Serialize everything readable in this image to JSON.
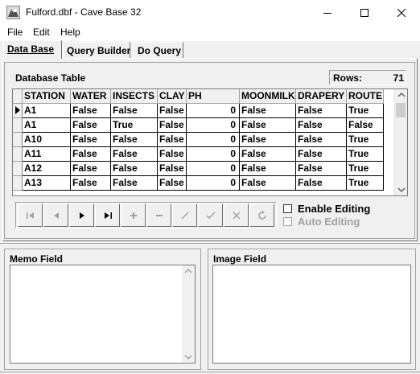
{
  "window": {
    "title": "Fulford.dbf - Cave Base 32",
    "icon": "cave-app-icon",
    "controls": [
      "minimize-icon",
      "maximize-icon",
      "close-icon"
    ]
  },
  "menu": {
    "items": [
      "File",
      "Edit",
      "Help"
    ]
  },
  "tabs": [
    {
      "label": "Data Base",
      "active": true
    },
    {
      "label": "Query Builder",
      "active": false
    },
    {
      "label": "Do Query",
      "active": false
    }
  ],
  "table_panel": {
    "title": "Database Table",
    "rows_label": "Rows:",
    "rows_value": "71"
  },
  "grid": {
    "columns": [
      "STATION",
      "WATER",
      "INSECTS",
      "CLAY",
      "PH",
      "MOONMILK",
      "DRAPERY",
      "ROUTE"
    ],
    "rows": [
      [
        "A1",
        "False",
        "False",
        "False",
        "0",
        "False",
        "False",
        "True"
      ],
      [
        "A1",
        "False",
        "True",
        "False",
        "0",
        "False",
        "False",
        "False"
      ],
      [
        "A10",
        "False",
        "False",
        "False",
        "0",
        "False",
        "False",
        "True"
      ],
      [
        "A11",
        "False",
        "False",
        "False",
        "0",
        "False",
        "False",
        "True"
      ],
      [
        "A12",
        "False",
        "False",
        "False",
        "0",
        "False",
        "False",
        "True"
      ],
      [
        "A13",
        "False",
        "False",
        "False",
        "0",
        "False",
        "False",
        "True"
      ]
    ],
    "current_row_indicator": "current-row-arrow-icon"
  },
  "navigator": {
    "buttons": [
      {
        "name": "first-record",
        "icon": "first-record-icon",
        "enabled": false
      },
      {
        "name": "prior-record",
        "icon": "prior-record-icon",
        "enabled": false
      },
      {
        "name": "next-record",
        "icon": "next-record-icon",
        "enabled": true
      },
      {
        "name": "last-record",
        "icon": "last-record-icon",
        "enabled": true
      },
      {
        "name": "insert-record",
        "icon": "plus-icon",
        "enabled": false
      },
      {
        "name": "delete-record",
        "icon": "minus-icon",
        "enabled": false
      },
      {
        "name": "edit-record",
        "icon": "edit-icon",
        "enabled": false
      },
      {
        "name": "post-edit",
        "icon": "check-icon",
        "enabled": false
      },
      {
        "name": "cancel-edit",
        "icon": "x-icon",
        "enabled": false
      },
      {
        "name": "refresh-data",
        "icon": "refresh-icon",
        "enabled": false
      }
    ]
  },
  "options": {
    "enable_editing": {
      "label": "Enable Editing",
      "checked": false,
      "enabled": true
    },
    "auto_editing": {
      "label": "Auto Editing",
      "checked": false,
      "enabled": false
    }
  },
  "memo": {
    "title": "Memo Field",
    "value": ""
  },
  "image": {
    "title": "Image Field"
  }
}
